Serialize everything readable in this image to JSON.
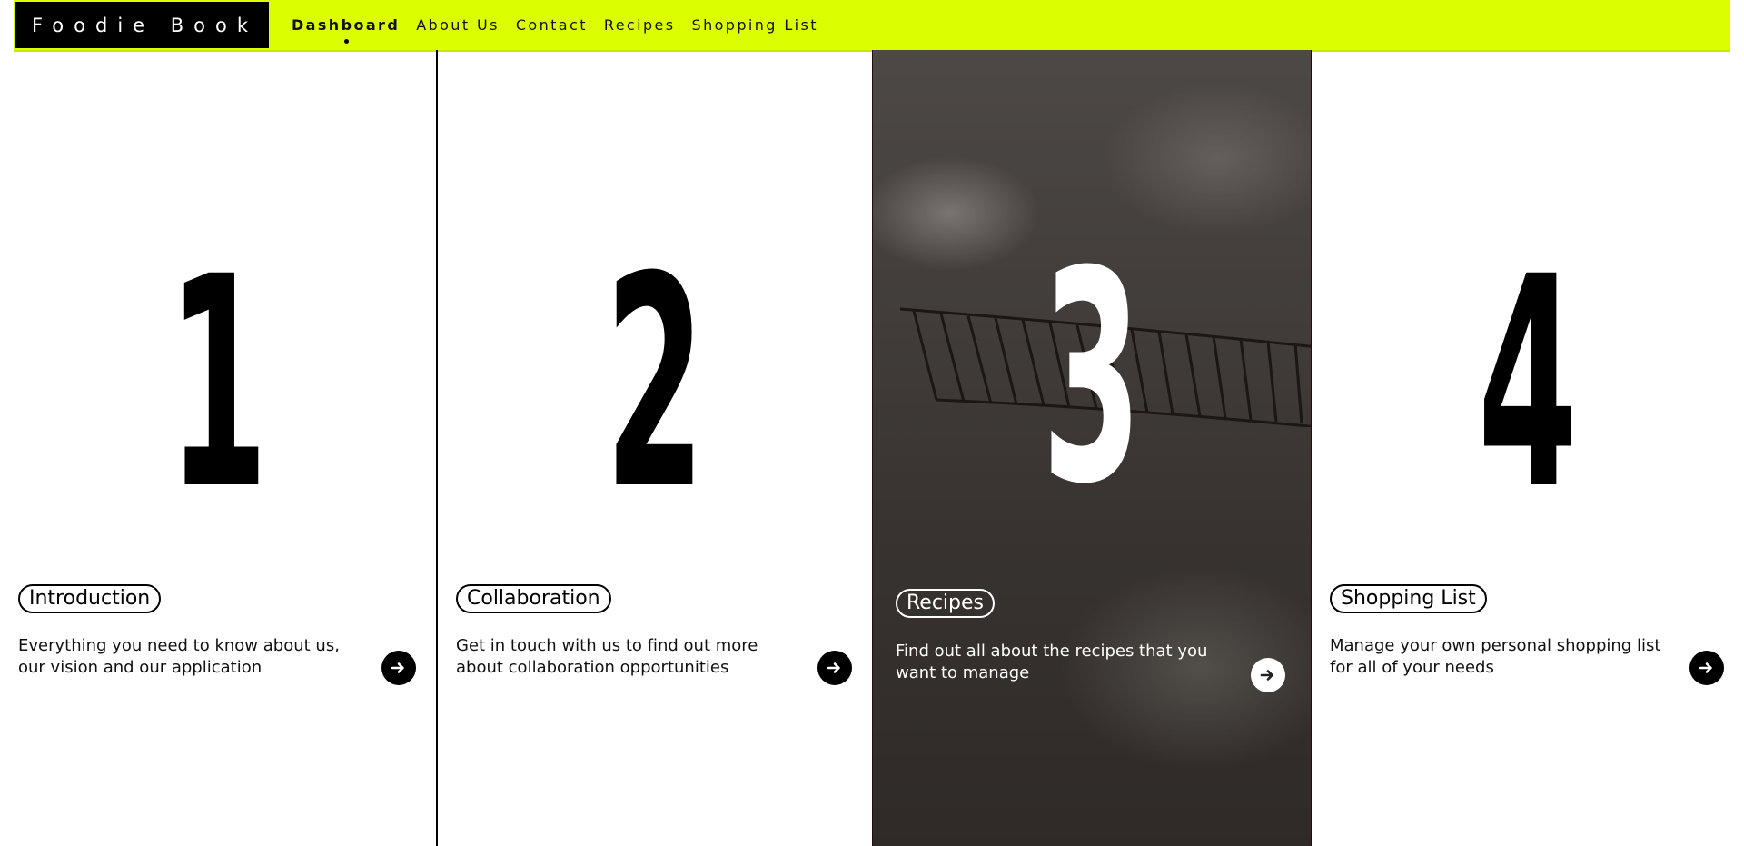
{
  "brand": {
    "name": "Foodie Book"
  },
  "nav": {
    "items": [
      {
        "label": "Dashboard",
        "active": true
      },
      {
        "label": "About Us",
        "active": false
      },
      {
        "label": "Contact",
        "active": false
      },
      {
        "label": "Recipes",
        "active": false
      },
      {
        "label": "Shopping List",
        "active": false
      }
    ]
  },
  "colors": {
    "nav_background": "#dcff00",
    "brand_background": "#000000",
    "accent_text": "#000000",
    "highlight_panel_text": "#ffffff"
  },
  "panels": [
    {
      "number": "1",
      "title": "Introduction",
      "description": "Everything you need to know about us, our vision and our application",
      "button_icon": "arrow-right-icon",
      "highlighted": false
    },
    {
      "number": "2",
      "title": "Collaboration",
      "description": "Get in touch with us to find out more about collaboration opportunities",
      "button_icon": "arrow-right-icon",
      "highlighted": false
    },
    {
      "number": "3",
      "title": "Recipes",
      "description": "Find out all about the recipes that you want to manage",
      "button_icon": "arrow-right-icon",
      "highlighted": true
    },
    {
      "number": "4",
      "title": "Shopping List",
      "description": "Manage your own personal shopping list for all of your needs",
      "button_icon": "arrow-right-icon",
      "highlighted": false
    }
  ]
}
